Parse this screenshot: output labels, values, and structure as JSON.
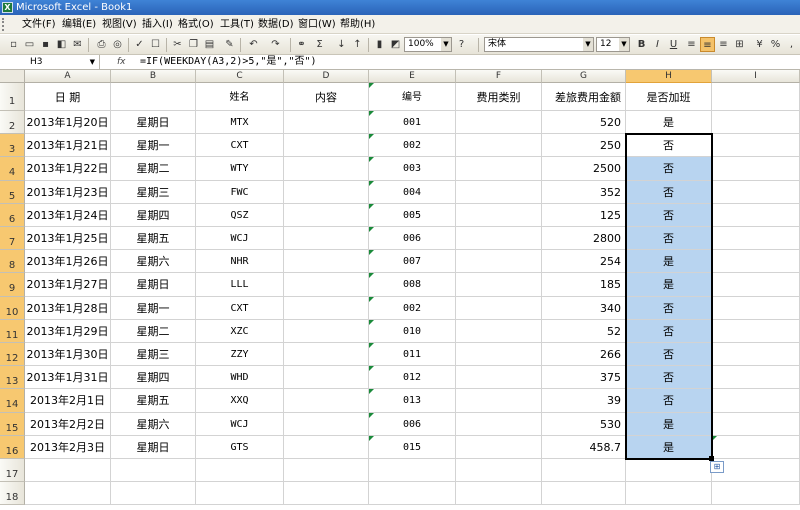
{
  "app": {
    "title": "Microsoft Excel - Book1",
    "icon": "excel-icon"
  },
  "menu": [
    {
      "label": "文件(F)"
    },
    {
      "label": "编辑(E)"
    },
    {
      "label": "视图(V)"
    },
    {
      "label": "插入(I)"
    },
    {
      "label": "格式(O)"
    },
    {
      "label": "工具(T)"
    },
    {
      "label": "数据(D)"
    },
    {
      "label": "窗口(W)"
    },
    {
      "label": "帮助(H)"
    }
  ],
  "toolbar": {
    "zoom": "100%",
    "font": "宋体",
    "font_size": "12",
    "bold": "B",
    "italic": "I",
    "underline": "U"
  },
  "formula_bar": {
    "name_box": "H3",
    "fx": "fx",
    "formula": "=IF(WEEKDAY(A3,2)>5,\"是\",\"否\")"
  },
  "columns": [
    "A",
    "B",
    "C",
    "D",
    "E",
    "F",
    "G",
    "H",
    "I"
  ],
  "rows": [
    {
      "n": "1",
      "A": "日  期",
      "B": "",
      "C": "姓名",
      "D": "内容",
      "E": "编号",
      "F": "费用类别",
      "G": "差旅费用金额",
      "H": "是否加班"
    },
    {
      "n": "2",
      "A": "2013年1月20日",
      "B": "星期日",
      "C": "MTX",
      "E": "001",
      "G": "520",
      "H": "是"
    },
    {
      "n": "3",
      "A": "2013年1月21日",
      "B": "星期一",
      "C": "CXT",
      "E": "002",
      "G": "250",
      "H": "否"
    },
    {
      "n": "4",
      "A": "2013年1月22日",
      "B": "星期二",
      "C": "WTY",
      "E": "003",
      "G": "2500",
      "H": "否"
    },
    {
      "n": "5",
      "A": "2013年1月23日",
      "B": "星期三",
      "C": "FWC",
      "E": "004",
      "G": "352",
      "H": "否"
    },
    {
      "n": "6",
      "A": "2013年1月24日",
      "B": "星期四",
      "C": "QSZ",
      "E": "005",
      "G": "125",
      "H": "否"
    },
    {
      "n": "7",
      "A": "2013年1月25日",
      "B": "星期五",
      "C": "WCJ",
      "E": "006",
      "G": "2800",
      "H": "否"
    },
    {
      "n": "8",
      "A": "2013年1月26日",
      "B": "星期六",
      "C": "NHR",
      "E": "007",
      "G": "254",
      "H": "是"
    },
    {
      "n": "9",
      "A": "2013年1月27日",
      "B": "星期日",
      "C": "LLL",
      "E": "008",
      "G": "185",
      "H": "是"
    },
    {
      "n": "10",
      "A": "2013年1月28日",
      "B": "星期一",
      "C": "CXT",
      "E": "002",
      "G": "340",
      "H": "否"
    },
    {
      "n": "11",
      "A": "2013年1月29日",
      "B": "星期二",
      "C": "XZC",
      "E": "010",
      "G": "52",
      "H": "否"
    },
    {
      "n": "12",
      "A": "2013年1月30日",
      "B": "星期三",
      "C": "ZZY",
      "E": "011",
      "G": "266",
      "H": "否"
    },
    {
      "n": "13",
      "A": "2013年1月31日",
      "B": "星期四",
      "C": "WHD",
      "E": "012",
      "G": "375",
      "H": "否"
    },
    {
      "n": "14",
      "A": "2013年2月1日",
      "B": "星期五",
      "C": "XXQ",
      "E": "013",
      "G": "39",
      "H": "否"
    },
    {
      "n": "15",
      "A": "2013年2月2日",
      "B": "星期六",
      "C": "WCJ",
      "E": "006",
      "G": "530",
      "H": "是"
    },
    {
      "n": "16",
      "A": "2013年2月3日",
      "B": "星期日",
      "C": "GTS",
      "E": "015",
      "G": "458.7",
      "H": "是"
    },
    {
      "n": "17"
    },
    {
      "n": "18"
    }
  ]
}
